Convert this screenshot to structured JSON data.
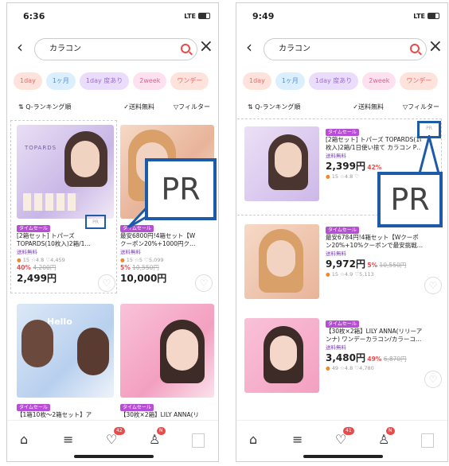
{
  "left": {
    "time": "6:36",
    "signal": "LTE",
    "search_value": "カラコン",
    "chips": [
      "1day",
      "1ヶ月",
      "1day 度あり",
      "2week",
      "ワンデー"
    ],
    "sort": {
      "rank": "⇅ Q-ランキング順",
      "ship": "✓送料無料",
      "filter": "▽フィルター"
    },
    "cards": [
      {
        "tag": "タイムセール",
        "title": "[2箱セット] トパーズ",
        "title2": "TOPARDS(10枚入)2箱/1…",
        "free": "送料無料",
        "rating": "15 ☆4.8 ♡4,459",
        "disc": "40%",
        "orig": "4,200円",
        "price": "2,499円",
        "pr": "PR",
        "img_text": "TOPARDS"
      },
      {
        "tag": "タイムセール",
        "title": "最安6800円!4箱セット【W",
        "title2": "クーポン20%+1000円ク…",
        "free": "送料無料",
        "rating": "15 ☆5 ♡5,099",
        "disc": "5%",
        "orig": "10,550円",
        "price": "10,000円"
      },
      {
        "tag": "タイムセール",
        "title": "【1箱10枚～2箱セット】ア",
        "img_text": "Hello"
      },
      {
        "tag": "タイムセール",
        "title": "【30枚×2箱】LILY ANNA(リ"
      }
    ],
    "pr_callout": "PR",
    "badge_heart": "42",
    "badge_user": "N"
  },
  "right": {
    "time": "9:49",
    "signal": "LTE",
    "search_value": "カラコン",
    "chips": [
      "1day",
      "1ヶ月",
      "1day 度あり",
      "2week",
      "ワンデー"
    ],
    "sort": {
      "rank": "⇅ Q-ランキング順",
      "ship": "✓送料無料",
      "filter": "▽フィルター"
    },
    "cards": [
      {
        "tag": "タイムセール",
        "title": "[2箱セット] トパーズ TOPARDS(10",
        "title2": "枚入)2箱/1日使い捨て カラコン P…",
        "free": "送料無料",
        "rating": "15 ☆4.8 ♡",
        "price": "2,399円",
        "disc": "42%",
        "pr": "PR"
      },
      {
        "tag": "タイムセール",
        "title": "最安6784円!4箱セット【Wクーポ",
        "title2": "ン20%+10%クーポンで最安挑戦…",
        "free": "送料無料",
        "rating": "15 ☆4.9 ♡5,113",
        "price": "9,972円",
        "disc": "5%",
        "orig": "10,550円"
      },
      {
        "tag": "タイムセール",
        "title": "【30枚×2箱】LILY ANNA(リリーア",
        "title2": "ンナ) ワンデーカラコン/カラーコ…",
        "free": "送料無料",
        "rating": "49 ☆4.8 ♡4,780",
        "price": "3,480円",
        "disc": "49%",
        "orig": "6,870円"
      }
    ],
    "pr_callout": "PR",
    "badge_heart": "41",
    "badge_user": "N"
  },
  "colors": {
    "accent": "#e84b4b",
    "tag": "#b74fd6",
    "callout": "#1d5aa8"
  }
}
